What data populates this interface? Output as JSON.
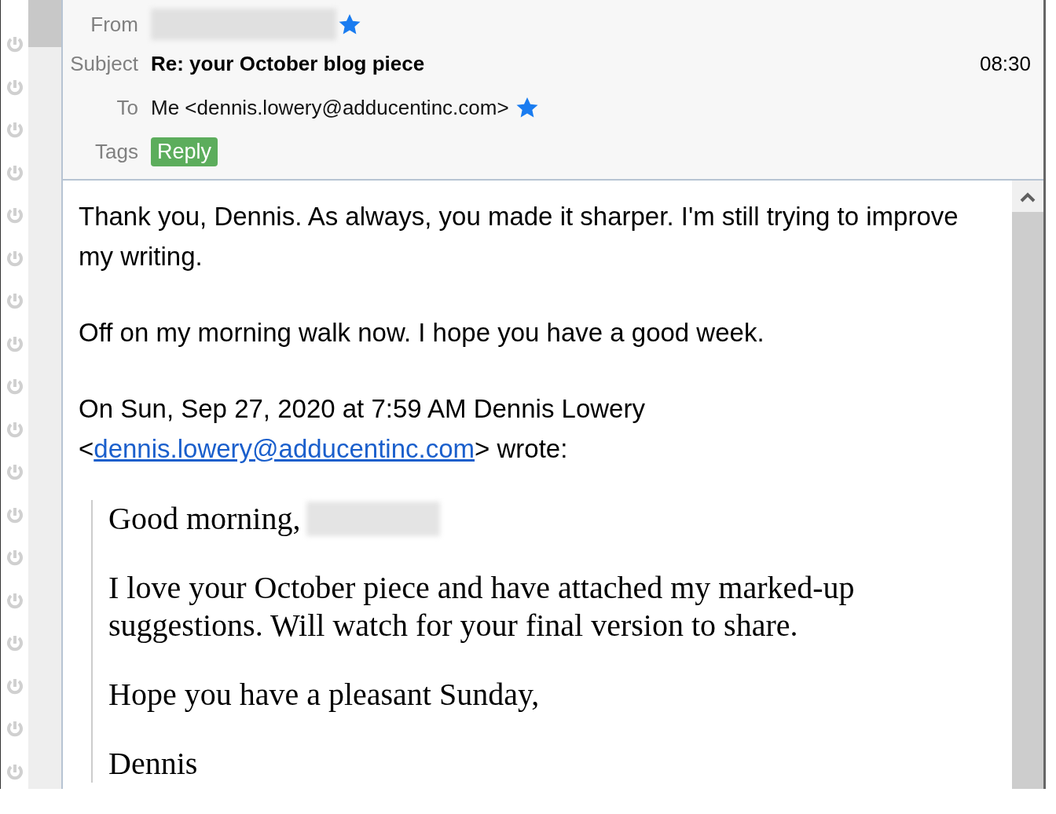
{
  "header": {
    "from_label": "From",
    "subject_label": "Subject",
    "subject": "Re: your October blog piece",
    "time": "08:30",
    "to_label": "To",
    "to": "Me <dennis.lowery@adducentinc.com>",
    "tags_label": "Tags",
    "tags": [
      {
        "label": "Reply",
        "color": "#5cad5c"
      }
    ]
  },
  "body": {
    "paragraphs": [
      "Thank you, Dennis. As always, you made it sharper. I'm still trying to improve my writing.",
      "Off on my morning walk now. I hope you have a good week."
    ],
    "attribution": {
      "before": "On Sun, Sep 27, 2020 at 7:59 AM Dennis Lowery <",
      "link": "dennis.lowery@adducentinc.com",
      "after": "> wrote:"
    },
    "quote": [
      {
        "kind": "greeting",
        "text": "Good morning,"
      },
      {
        "kind": "text",
        "text": "I love your October piece and have attached my marked-up suggestions. Will watch for your final version to share."
      },
      {
        "kind": "text",
        "text": "Hope you have a pleasant Sunday,"
      },
      {
        "kind": "text",
        "text": "Dennis"
      }
    ]
  }
}
